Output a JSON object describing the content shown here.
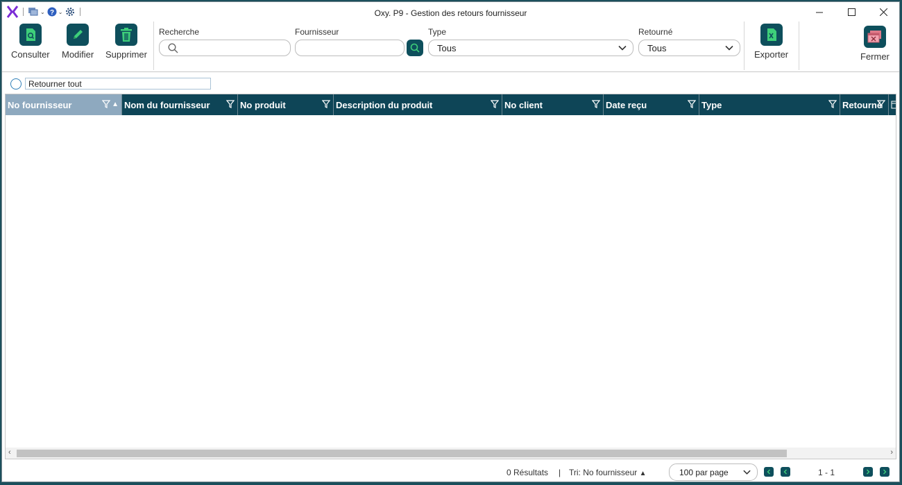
{
  "window": {
    "title": "Oxy. P9 - Gestion des retours fournisseur",
    "controls": [
      "minimize-icon",
      "maximize-icon",
      "close-icon"
    ]
  },
  "quick_access": {
    "icons": [
      "app-logo-icon",
      "windows-icon",
      "help-icon",
      "settings-icon"
    ]
  },
  "ribbon": {
    "consulter": "Consulter",
    "modifier": "Modifier",
    "supprimer": "Supprimer",
    "exporter": "Exporter",
    "fermer": "Fermer"
  },
  "filters": {
    "recherche": {
      "label": "Recherche",
      "value": ""
    },
    "fournisseur": {
      "label": "Fournisseur",
      "value": ""
    },
    "type": {
      "label": "Type",
      "value": "Tous"
    },
    "retourne": {
      "label": "Retourné",
      "value": "Tous"
    }
  },
  "retourner_tout": "Retourner tout",
  "grid": {
    "columns": [
      "No fournisseur",
      "Nom du fournisseur",
      "No produit",
      "Description du produit",
      "No client",
      "Date reçu",
      "Type",
      "Retourné"
    ],
    "sorted_column": "No fournisseur",
    "rows": []
  },
  "status": {
    "results": "0 Résultats",
    "separator": "|",
    "sort": "Tri: No fournisseur",
    "per_page": "100 par page",
    "range": "1 - 1"
  },
  "colors": {
    "accent": "#0e4f5c",
    "header_bg": "#0e4557",
    "sorted_header": "#8ea9bf"
  }
}
